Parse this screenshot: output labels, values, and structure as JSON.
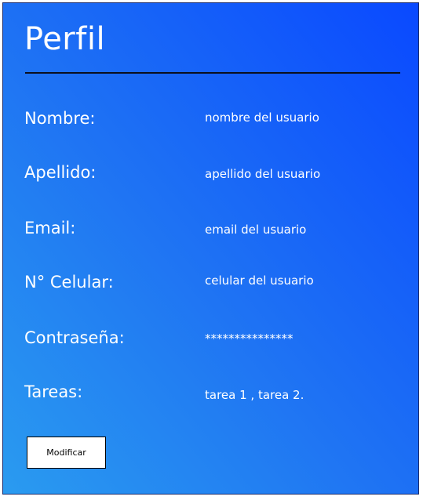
{
  "profile": {
    "title": "Perfil",
    "fields": [
      {
        "label": "Nombre:",
        "value": "nombre del usuario"
      },
      {
        "label": "Apellido:",
        "value": "apellido del usuario"
      },
      {
        "label": "Email:",
        "value": "email del usuario"
      },
      {
        "label": "N° Celular:",
        "value": "celular del usuario"
      },
      {
        "label": "Contraseña:",
        "value": "***************"
      },
      {
        "label": "Tareas:",
        "value": "tarea 1 , tarea 2."
      }
    ],
    "modify_button_label": "Modificar"
  },
  "colors": {
    "gradient_start": "#2a9bf0",
    "gradient_end": "#0a49ff",
    "text": "#ffffff",
    "divider": "#0b0f1e"
  }
}
